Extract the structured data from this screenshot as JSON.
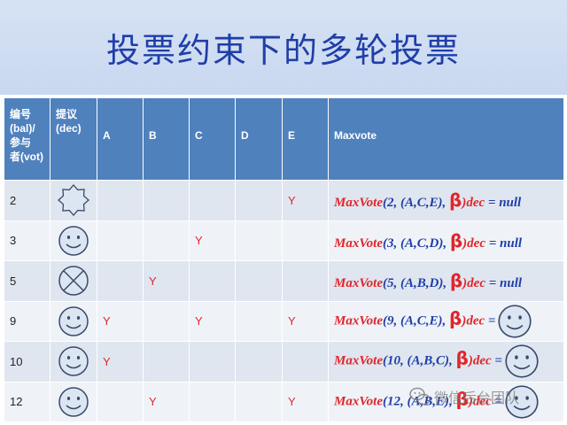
{
  "title": "投票约束下的多轮投票",
  "table": {
    "headers": {
      "ballot_lines": [
        "编号",
        "(bal)/",
        "参与",
        "者(vot)"
      ],
      "decision_lines": [
        "提议",
        "(dec)"
      ],
      "a": "A",
      "b": "B",
      "c": "C",
      "d": "D",
      "e": "E",
      "maxvote": "Maxvote"
    },
    "rows": [
      {
        "num": "2",
        "icon": "star-burst-icon",
        "a": "",
        "b": "",
        "c": "",
        "d": "",
        "e": "Y",
        "f": {
          "name": "MaxVote",
          "args": "(2, (A,C,E), ",
          "beta": "β",
          "dec": ")dec",
          "result": " = null"
        }
      },
      {
        "num": "3",
        "icon": "smiley-face-icon",
        "a": "",
        "b": "",
        "c": "Y",
        "d": "",
        "e": "",
        "f": {
          "name": "MaxVote",
          "args": "(3, (A,C,D), ",
          "beta": "β",
          "dec": ")dec",
          "result": " = null"
        }
      },
      {
        "num": "5",
        "icon": "crossed-circle-icon",
        "a": "",
        "b": "Y",
        "c": "",
        "d": "",
        "e": "",
        "f": {
          "name": "MaxVote",
          "args": "(5, (A,B,D), ",
          "beta": "β",
          "dec": ")dec",
          "result": " = null"
        }
      },
      {
        "num": "9",
        "icon": "smiley-face-icon",
        "a": "Y",
        "b": "",
        "c": "Y",
        "d": "",
        "e": "Y",
        "f": {
          "name": "MaxVote",
          "args": "(9, (A,C,E), ",
          "beta": "β",
          "dec": ")dec",
          "result": " ="
        }
      },
      {
        "num": "10",
        "icon": "smiley-face-icon",
        "a": "Y",
        "b": "",
        "c": "",
        "d": "",
        "e": "",
        "f": {
          "name": "MaxVote",
          "args": "(10, (A,B,C), ",
          "beta": "β",
          "dec": ")dec",
          "result": " ="
        }
      },
      {
        "num": "12",
        "icon": "smiley-face-icon",
        "a": "",
        "b": "Y",
        "c": "",
        "d": "",
        "e": "Y",
        "f": {
          "name": "MaxVote",
          "args": "(12, (A,B,E), ",
          "beta": "β",
          "dec": ")dec",
          "result": " ="
        }
      }
    ]
  },
  "watermark": "微信后台团队",
  "colors": {
    "header": "#4f81bd",
    "mark_red": "#e0262b",
    "formula_blue": "#1f3ea8",
    "title": "#1f3ea8"
  }
}
